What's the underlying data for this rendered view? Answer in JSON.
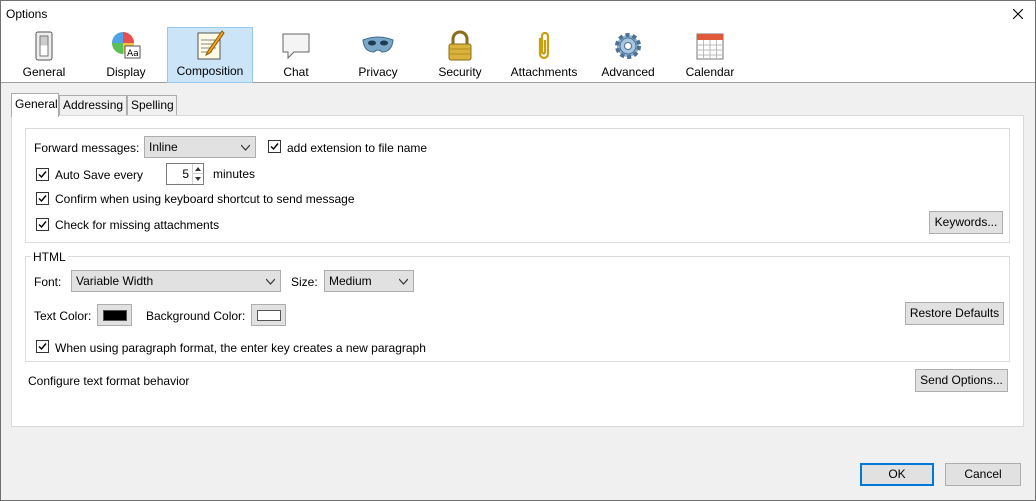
{
  "window": {
    "title": "Options"
  },
  "panes": [
    {
      "label": "General",
      "icon": "light-switch-icon"
    },
    {
      "label": "Display",
      "icon": "display-palette-icon"
    },
    {
      "label": "Composition",
      "icon": "notepad-pencil-icon"
    },
    {
      "label": "Chat",
      "icon": "speech-bubble-icon"
    },
    {
      "label": "Privacy",
      "icon": "mask-icon"
    },
    {
      "label": "Security",
      "icon": "padlock-icon"
    },
    {
      "label": "Attachments",
      "icon": "paperclip-icon"
    },
    {
      "label": "Advanced",
      "icon": "gear-icon"
    },
    {
      "label": "Calendar",
      "icon": "calendar-icon"
    }
  ],
  "selected_pane": "Composition",
  "tabs": [
    {
      "label": "General"
    },
    {
      "label": "Addressing"
    },
    {
      "label": "Spelling"
    }
  ],
  "general_group": {
    "forward_label": "Forward messages:",
    "forward_value": "Inline",
    "add_extension_label": "add extension to file name",
    "add_extension_checked": true,
    "autosave_label": "Auto Save every",
    "autosave_checked": true,
    "autosave_value": "5",
    "autosave_unit": "minutes",
    "confirm_label": "Confirm when using keyboard shortcut to send message",
    "confirm_checked": true,
    "missing_label": "Check for missing attachments",
    "missing_checked": true,
    "keywords_button": "Keywords..."
  },
  "html_group": {
    "caption": "HTML",
    "font_label": "Font:",
    "font_value": "Variable Width",
    "size_label": "Size:",
    "size_value": "Medium",
    "text_color_label": "Text Color:",
    "text_color": "#000000",
    "bg_color_label": "Background Color:",
    "bg_color": "#ffffff",
    "restore_button": "Restore Defaults",
    "paragraph_label": "When using paragraph format, the enter key creates a new paragraph",
    "paragraph_checked": true
  },
  "send_format": {
    "label": "Configure text format behavior",
    "button": "Send Options..."
  },
  "footer": {
    "ok": "OK",
    "cancel": "Cancel"
  },
  "colors": {
    "accent": "#0078d7",
    "selected_pane_bg": "#cce4f7"
  }
}
